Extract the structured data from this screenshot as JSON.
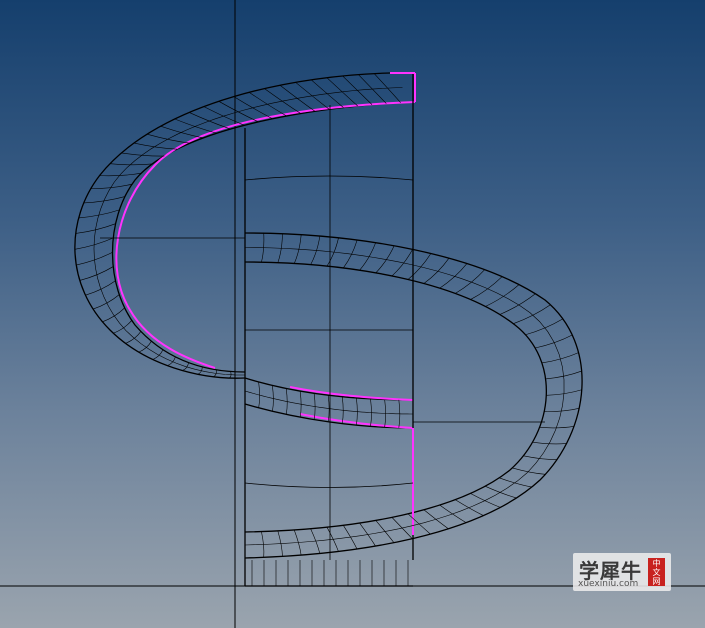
{
  "viewport": {
    "background_top": "#153f6d",
    "background_bottom": "#9aa4ae",
    "edge_color": "#000000",
    "selection_color": "#ff33ff"
  },
  "watermark": {
    "chinese_text": "学犀牛",
    "site_text": "xuexiniu.com",
    "badge_chars": [
      "中",
      "文",
      "网"
    ]
  }
}
